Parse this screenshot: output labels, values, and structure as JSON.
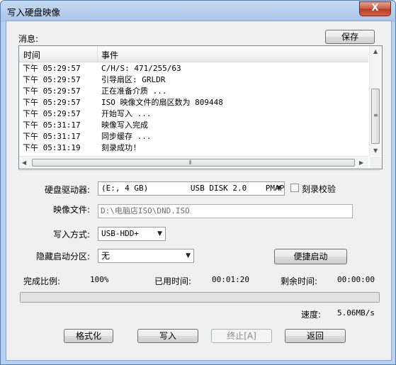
{
  "window": {
    "title": "写入硬盘映像",
    "close_label": "X"
  },
  "log": {
    "label": "消息:",
    "save_button": "保存",
    "columns": [
      "时间",
      "事件"
    ],
    "rows": [
      {
        "time": "下午 05:29:57",
        "event": "C/H/S: 471/255/63"
      },
      {
        "time": "下午 05:29:57",
        "event": "引导扇区: GRLDR"
      },
      {
        "time": "下午 05:29:57",
        "event": "正在准备介质 ..."
      },
      {
        "time": "下午 05:29:57",
        "event": "ISO 映像文件的扇区数为 809448"
      },
      {
        "time": "下午 05:29:57",
        "event": "开始写入 ..."
      },
      {
        "time": "下午 05:31:17",
        "event": "映像写入完成"
      },
      {
        "time": "下午 05:31:17",
        "event": "同步缓存 ..."
      },
      {
        "time": "下午 05:31:19",
        "event": "刻录成功!"
      }
    ]
  },
  "form": {
    "drive_label": "硬盘驱动器:",
    "drive_value": "(E:, 4 GB)         USB DISK 2.0    PMAP",
    "verify_label": "刻录校验",
    "verify_checked": false,
    "image_label": "映像文件:",
    "image_value": "D:\\电脑店ISO\\DND.ISO",
    "write_mode_label": "写入方式:",
    "write_mode_value": "USB-HDD+",
    "hidden_partition_label": "隐藏启动分区:",
    "hidden_partition_value": "无",
    "quick_boot_button": "便捷启动"
  },
  "progress": {
    "complete_label": "完成比例:",
    "complete_value": "100%",
    "elapsed_label": "已用时间:",
    "elapsed_value": "00:01:20",
    "remaining_label": "剩余时间:",
    "remaining_value": "00:00:00",
    "fraction": 1.0,
    "speed_label": "速度:",
    "speed_value": "5.06MB/s"
  },
  "buttons": {
    "format": "格式化",
    "write": "写入",
    "stop": "终止[A]",
    "back": "返回"
  }
}
